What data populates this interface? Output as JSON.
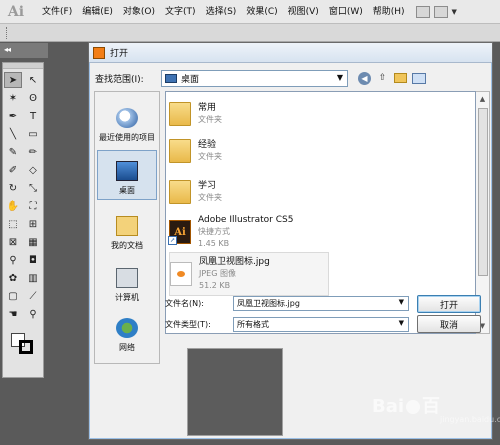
{
  "app": {
    "logo": "Ai"
  },
  "menubar": {
    "items": [
      "文件(F)",
      "编辑(E)",
      "对象(O)",
      "文字(T)",
      "选择(S)",
      "效果(C)",
      "视图(V)",
      "窗口(W)",
      "帮助(H)"
    ]
  },
  "toolstrip": {
    "collapse_glyph": "◂◂"
  },
  "dialog": {
    "title": "打开",
    "lookin_label": "查找范围(I):",
    "lookin_value": "桌面",
    "places": [
      "最近使用的项目",
      "桌面",
      "我的文档",
      "计算机",
      "网络"
    ],
    "files": [
      {
        "name": "常用",
        "type": "文件夹",
        "size": "",
        "icon": "folder-icon"
      },
      {
        "name": "经验",
        "type": "文件夹",
        "size": "",
        "icon": "folder-icon"
      },
      {
        "name": "学习",
        "type": "文件夹",
        "size": "",
        "icon": "folder-icon"
      },
      {
        "name": "Adobe Illustrator CS5",
        "type": "快捷方式",
        "size": "1.45 KB",
        "icon": "illustrator-shortcut-icon"
      },
      {
        "name": "凤凰卫视图标.jpg",
        "type": "JPEG 图像",
        "size": "51.2 KB",
        "icon": "jpeg-image-icon"
      }
    ],
    "filename_label": "文件名(N):",
    "filename_value": "凤凰卫视图标.jpg",
    "filetype_label": "文件类型(T):",
    "filetype_value": "所有格式",
    "open_label": "打开",
    "cancel_label": "取消"
  },
  "watermark": {
    "text": "Bai",
    "text2": "百",
    "sub": "jingyan.baidu.com"
  }
}
